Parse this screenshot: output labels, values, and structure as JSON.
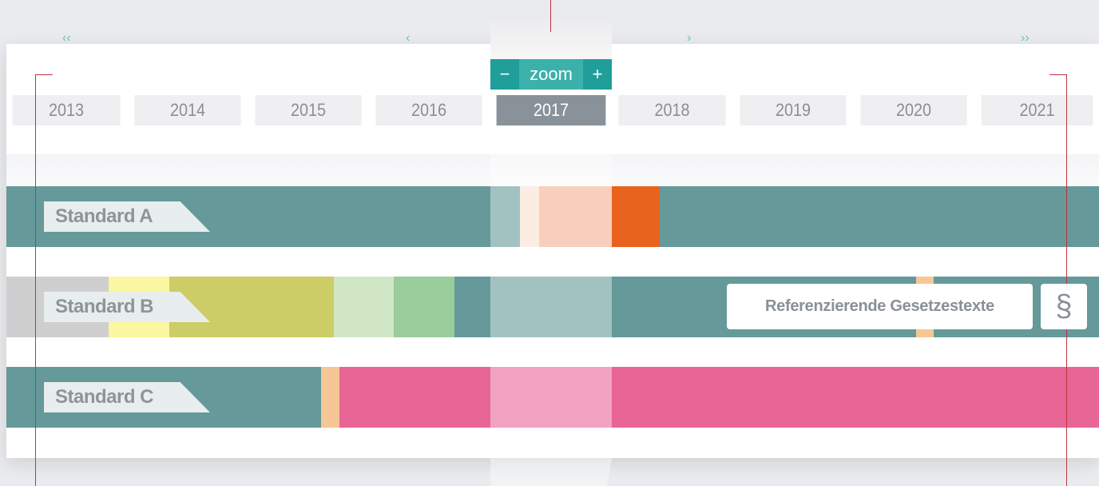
{
  "timeline": {
    "years": [
      "2013",
      "2014",
      "2015",
      "2016",
      "2017",
      "2018",
      "2019",
      "2020",
      "2021"
    ],
    "selected_year": "2017"
  },
  "zoom": {
    "minus": "−",
    "label": "zoom",
    "plus": "+"
  },
  "standards": [
    {
      "label": "Standard A"
    },
    {
      "label": "Standard B"
    },
    {
      "label": "Standard C"
    }
  ],
  "references": {
    "button_label": "Referenzierende Gesetzestexte",
    "section_symbol": "§"
  },
  "colors": {
    "teal": "#65999a",
    "zoom_teal": "#1f9e9a",
    "zoom_label": "#3cb1ab",
    "selected_year": "#8a9299",
    "red_marker": "#c0343f",
    "orange_dark": "#e8631e",
    "salmon": "#f3b090",
    "pink": "#e86695",
    "olive": "#cccd66",
    "light_yellow": "#fbf6a1"
  }
}
